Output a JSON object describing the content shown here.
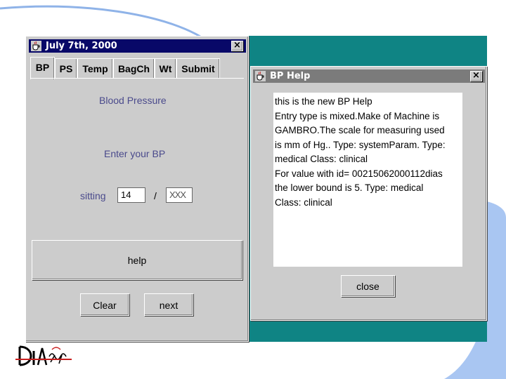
{
  "main_window": {
    "title": "July 7th, 2000",
    "close_glyph": "×",
    "tabs": [
      {
        "label": "BP",
        "active": true
      },
      {
        "label": "PS",
        "active": false
      },
      {
        "label": "Temp",
        "active": false
      },
      {
        "label": "BagCh",
        "active": false
      },
      {
        "label": "Wt",
        "active": false
      },
      {
        "label": "Submit",
        "active": false
      }
    ],
    "heading": "Blood Pressure",
    "prompt": "Enter your BP",
    "posture_label": "sitting",
    "systolic_value": "14",
    "separator": "/",
    "diastolic_value": "XXX",
    "help_button": "help",
    "clear_button": "Clear",
    "next_button": "next"
  },
  "help_window": {
    "title": "BP Help",
    "close_glyph": "×",
    "text_lines": [
      "this is the new BP Help",
      "Entry type is mixed.Make of Machine is",
      "GAMBRO.The scale for measuring used",
      "is mm of Hg.. Type: systemParam. Type:",
      "medical Class: clinical",
      "For value with id= 00215062000112dias",
      "the lower bound is 5. Type: medical",
      "Class: clinical"
    ],
    "close_button": "close"
  },
  "colors": {
    "desktop": "#0f8484",
    "active_title": "#080868",
    "inactive_title": "#7b7b7b",
    "label_text": "#4a4a8c",
    "window_bg": "#cccccc"
  },
  "icons": [
    "java-cup-icon",
    "close-icon",
    "logo-icon"
  ]
}
